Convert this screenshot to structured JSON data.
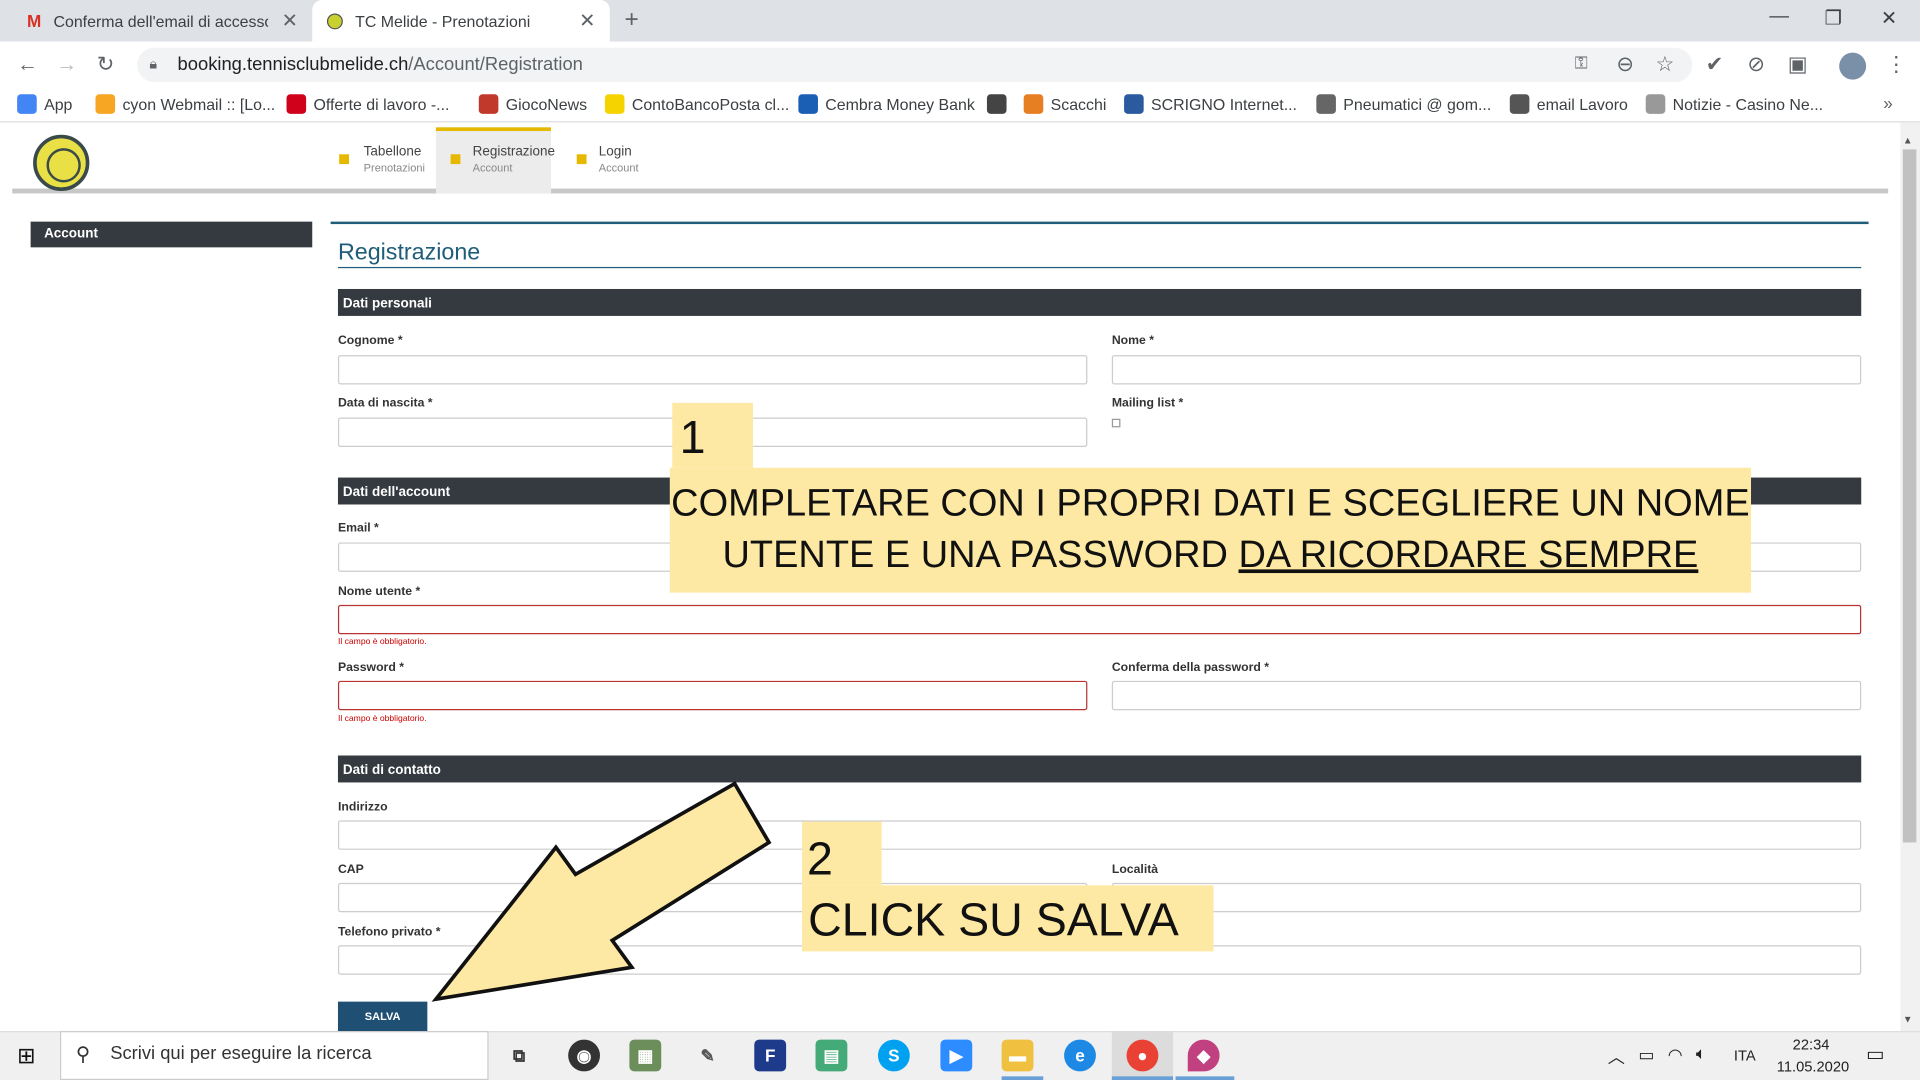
{
  "browser": {
    "tabs": [
      {
        "title": "Conferma dell'email di accesso -",
        "icon": "gmail-icon"
      },
      {
        "title": "TC Melide - Prenotazioni",
        "icon": "tennis-ball-icon"
      }
    ],
    "url_domain": "booking.tennisclubmelide.ch",
    "url_path": "/Account/Registration",
    "bookmarks": [
      {
        "label": "App",
        "color": "#4285f4"
      },
      {
        "label": "cyon Webmail :: [Lo...",
        "color": "#f6a623"
      },
      {
        "label": "Offerte di lavoro -...",
        "color": "#d0021b"
      },
      {
        "label": "GiocoNews",
        "color": "#c0392b"
      },
      {
        "label": "ContoBancoPosta cl...",
        "color": "#f5d300"
      },
      {
        "label": "Cembra Money Bank",
        "color": "#1a5fb4"
      },
      {
        "label": "",
        "color": "#444444"
      },
      {
        "label": "Scacchi",
        "color": "#e67e22"
      },
      {
        "label": "SCRIGNO Internet...",
        "color": "#2c5aa0"
      },
      {
        "label": "Pneumatici @ gom...",
        "color": "#666666"
      },
      {
        "label": "email Lavoro",
        "color": "#555555"
      },
      {
        "label": "Notizie - Casino Ne...",
        "color": "#999999"
      }
    ],
    "bookmarks_more": "»"
  },
  "site": {
    "nav": [
      {
        "title": "Tabellone",
        "sub": "Prenotazioni"
      },
      {
        "title": "Registrazione",
        "sub": "Account"
      },
      {
        "title": "Login",
        "sub": "Account"
      }
    ],
    "sidebar": "Account",
    "page_title": "Registrazione",
    "sections": {
      "personal": "Dati personali",
      "account": "Dati dell'account",
      "contact": "Dati di contatto"
    },
    "labels": {
      "cognome": "Cognome *",
      "nome": "Nome *",
      "nascita": "Data di nascita *",
      "mailing": "Mailing list *",
      "email": "Email *",
      "username": "Nome utente *",
      "password": "Password *",
      "confirm": "Conferma della password *",
      "indirizzo": "Indirizzo",
      "cap": "CAP",
      "localita": "Località",
      "telefono": "Telefono privato *"
    },
    "error": "Il campo è obbligatorio.",
    "save": "SALVA"
  },
  "callouts": {
    "n1": "1",
    "c1_line1": "COMPLETARE CON I PROPRI DATI E SCEGLIERE UN NOME",
    "c1_line2a": "UTENTE E UNA PASSWORD ",
    "c1_line2b": "DA RICORDARE SEMPRE",
    "n2": "2",
    "c2": "CLICK SU SALVA"
  },
  "taskbar": {
    "search": "Scrivi qui per eseguire la ricerca",
    "lang": "ITA",
    "time": "22:34",
    "date": "11.05.2020"
  }
}
